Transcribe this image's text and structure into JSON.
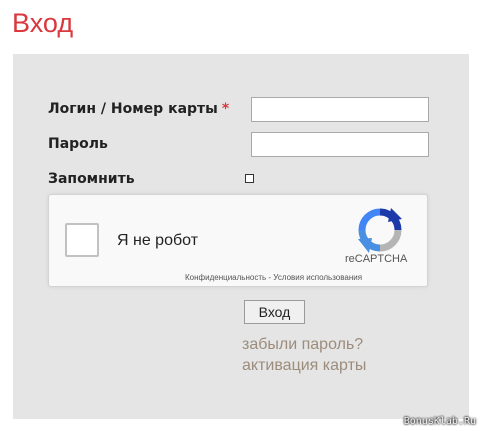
{
  "page": {
    "title": "Вход"
  },
  "form": {
    "login_label": "Логин / Номер карты",
    "required_mark": "*",
    "password_label": "Пароль",
    "remember_label": "Запомнить",
    "login_value": "",
    "password_value": "",
    "remember_checked": false
  },
  "recaptcha": {
    "checkbox_label": "Я не робот",
    "brand": "reCAPTCHA",
    "privacy_link": "Конфиденциальность",
    "separator": " - ",
    "terms_link": "Условия использования"
  },
  "actions": {
    "submit_label": "Вход",
    "forgot_password": "забыли пароль?",
    "activate_card": "активация карты"
  },
  "watermark": "BonusKlab.Ru",
  "colors": {
    "title": "#d9383d",
    "required": "#d9383d",
    "panel": "#e5e5e5",
    "links": "#9c8c7c"
  }
}
